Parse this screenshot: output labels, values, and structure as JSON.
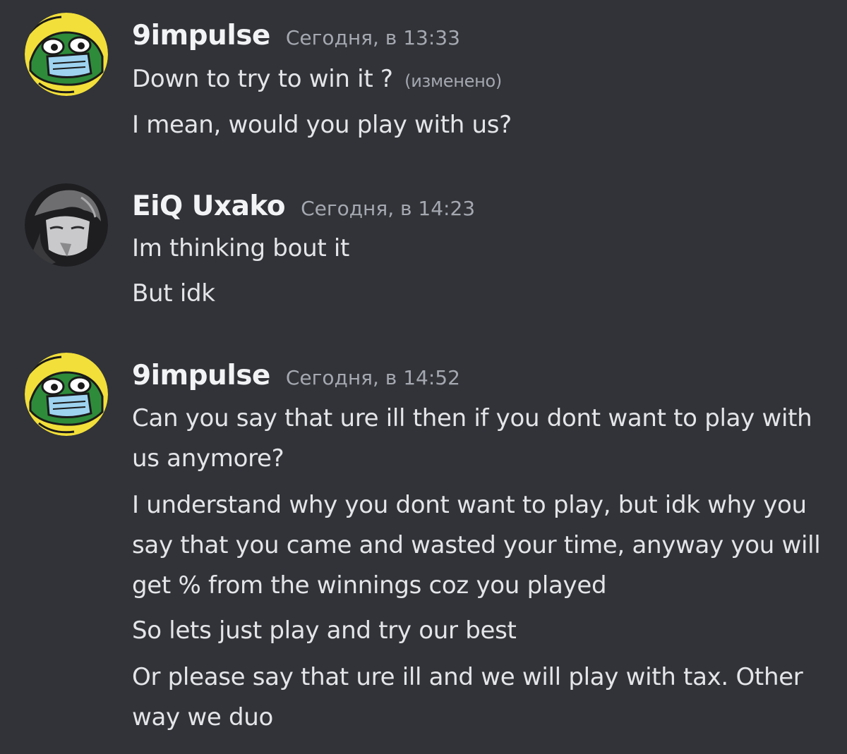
{
  "messages": [
    {
      "username": "9impulse",
      "timestamp": "Сегодня, в 13:33",
      "lines": [
        {
          "text": "Down to try to win it ?",
          "edited": "(изменено)"
        },
        {
          "text": "I mean, would you play with us?"
        }
      ]
    },
    {
      "username": "EiQ Uxako",
      "timestamp": "Сегодня, в 14:23",
      "lines": [
        {
          "text": "Im thinking bout it"
        },
        {
          "text": "But idk"
        }
      ]
    },
    {
      "username": "9impulse",
      "timestamp": "Сегодня, в 14:52",
      "lines": [
        {
          "text": "Can you say that ure ill then if you dont want to play with us anymore?"
        },
        {
          "text": "I understand why you dont want to play, but idk why you say that you came and wasted your time, anyway you will get % from the winnings coz you played"
        },
        {
          "text": "So lets just play and try our best"
        },
        {
          "text": "Or please say that ure ill and we will play with tax. Other way we duo"
        }
      ]
    }
  ],
  "icons": {
    "avatar_1": "frog-avatar-icon",
    "avatar_2": "grayscale-portrait-avatar-icon",
    "avatar_3": "frog-avatar-icon"
  },
  "colors": {
    "background": "#313338",
    "username": "#f2f3f5",
    "timestamp": "#a5a8b0",
    "message_text": "#e3e5e8",
    "avatar_frog_bg": "#f2df3a"
  }
}
